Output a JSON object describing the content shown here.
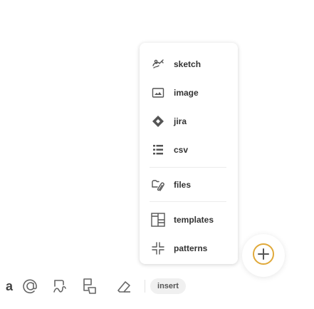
{
  "insert_menu": {
    "items": [
      {
        "label": "sketch",
        "icon": "hand-sketch-icon"
      },
      {
        "label": "image",
        "icon": "image-icon"
      },
      {
        "label": "jira",
        "icon": "jira-diamond-icon"
      },
      {
        "label": "csv",
        "icon": "table-list-icon"
      },
      {
        "label": "files",
        "icon": "paperclip-files-icon"
      },
      {
        "label": "templates",
        "icon": "templates-icon"
      },
      {
        "label": "patterns",
        "icon": "patterns-icon"
      }
    ]
  },
  "toolbar": {
    "letter": "a",
    "insert_label": "insert",
    "tools": [
      "at-sign-icon",
      "lasso-icon",
      "shapes-icon",
      "eraser-icon"
    ]
  },
  "fab": {
    "icon": "plus-icon",
    "accent": "#e0a93a"
  }
}
